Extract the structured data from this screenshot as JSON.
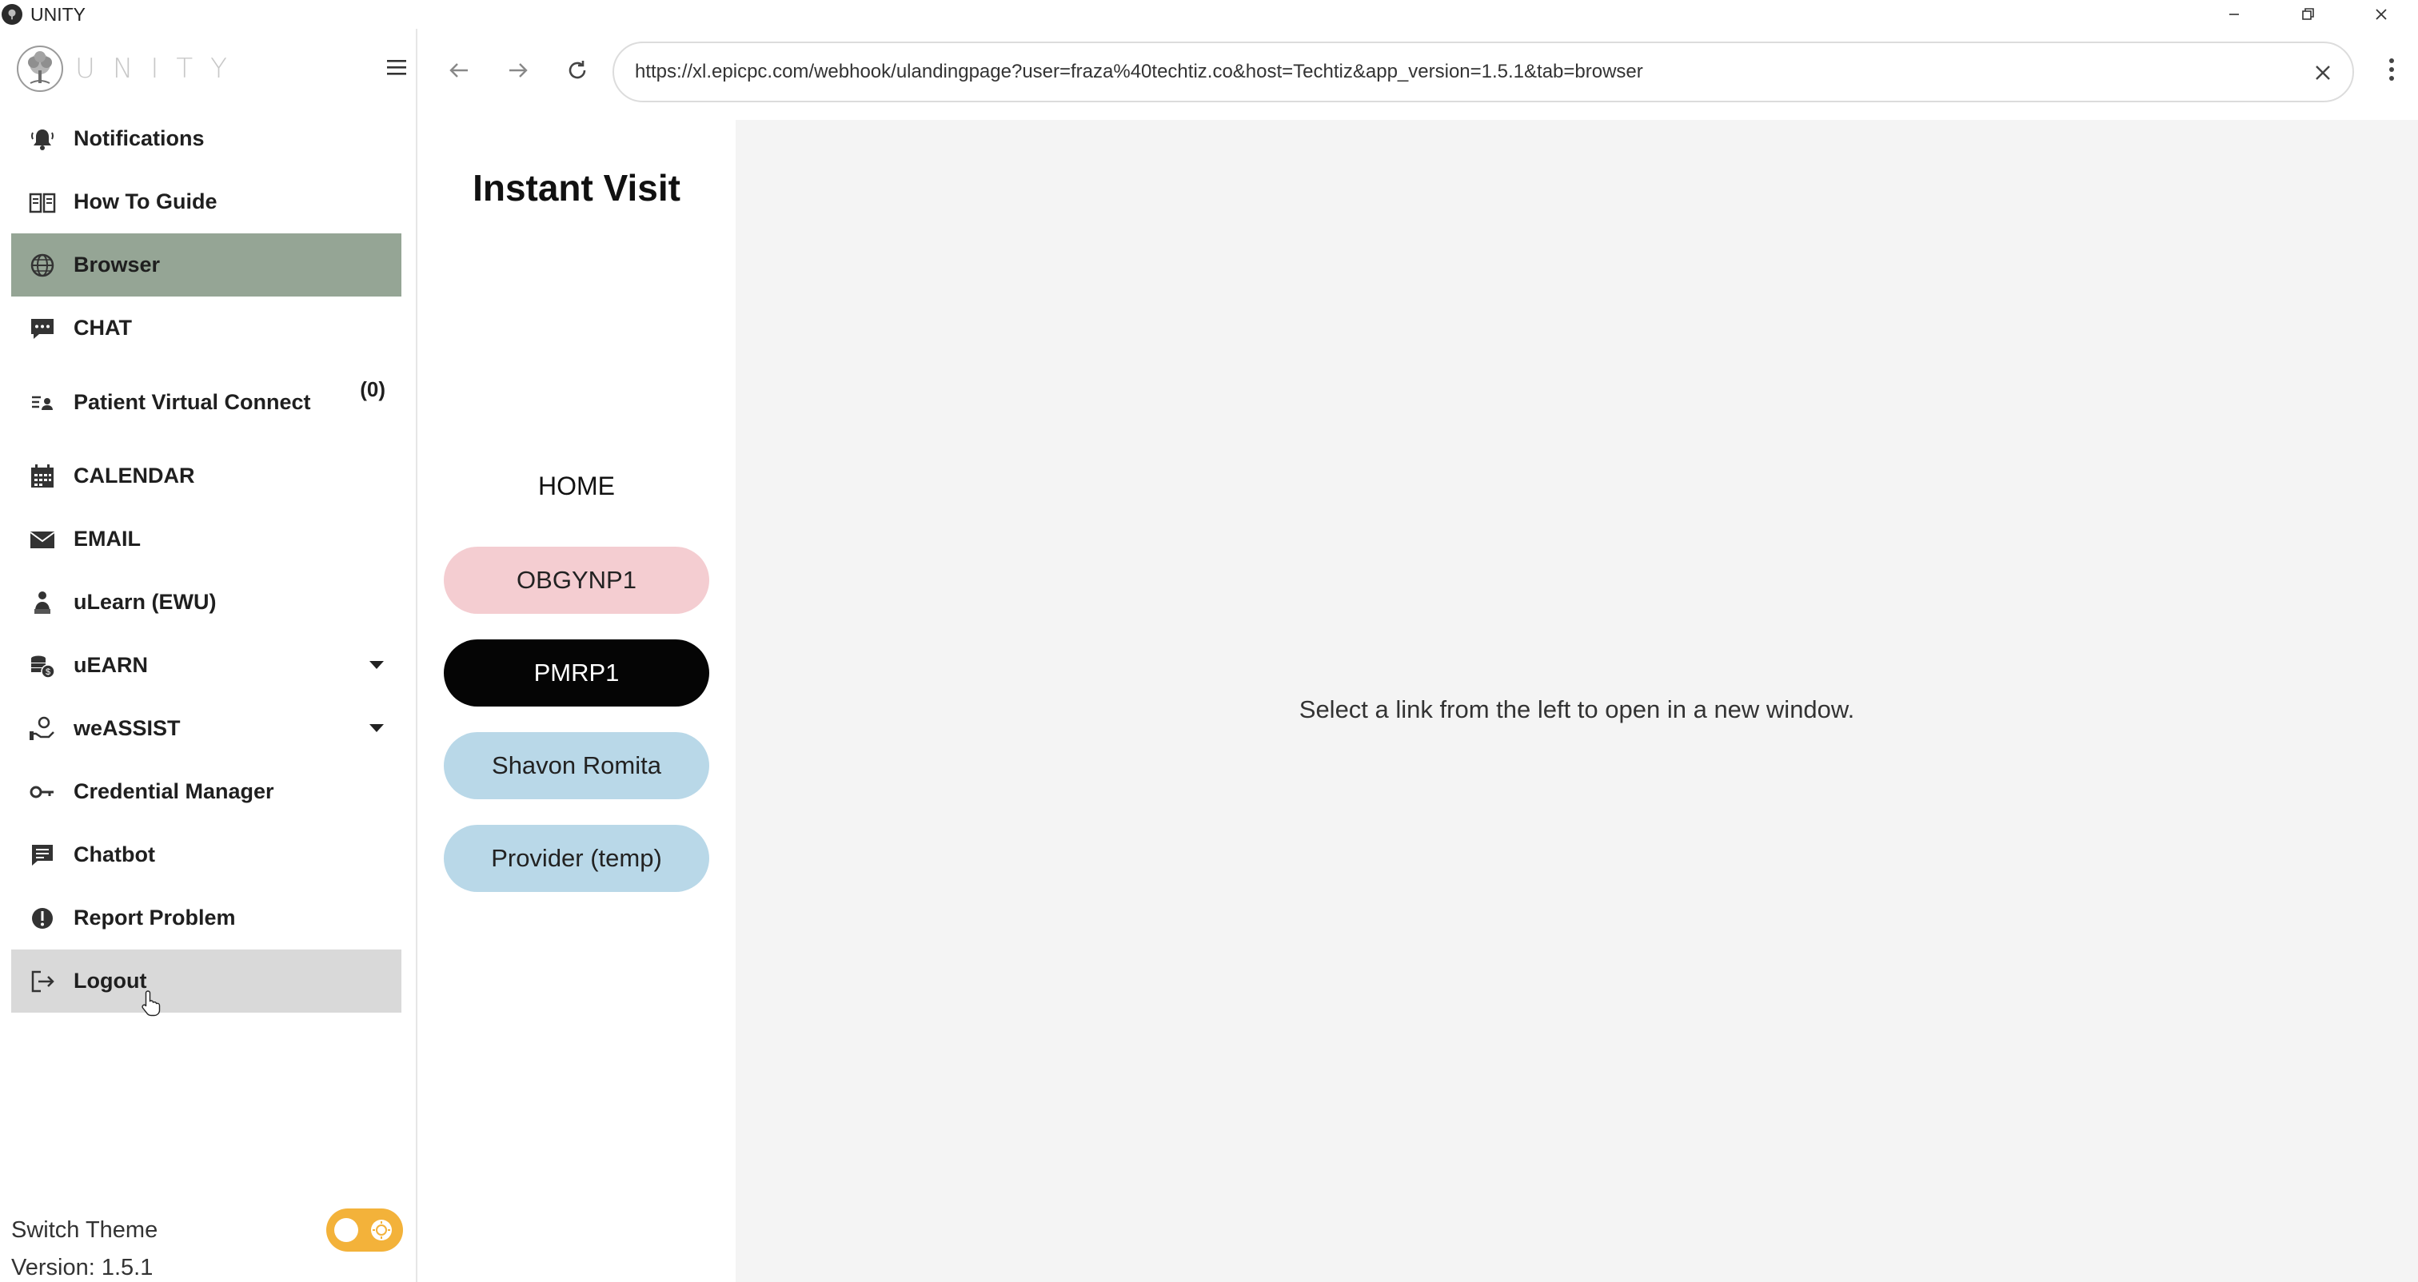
{
  "window": {
    "title": "UNITY",
    "controls": {
      "minimize": "minimize-icon",
      "restore": "restore-icon",
      "close": "close-icon"
    }
  },
  "sidebar": {
    "brand": "UNITY",
    "items": [
      {
        "label": "Notifications",
        "icon": "bell-icon"
      },
      {
        "label": "How To Guide",
        "icon": "book-icon"
      },
      {
        "label": "Browser",
        "icon": "globe-icon",
        "active": true
      },
      {
        "label": "CHAT",
        "icon": "chat-bubble-icon"
      },
      {
        "label": "Patient Virtual Connect",
        "icon": "patient-list-icon",
        "count": "(0)"
      },
      {
        "label": "CALENDAR",
        "icon": "calendar-icon"
      },
      {
        "label": "EMAIL",
        "icon": "envelope-icon"
      },
      {
        "label": "uLearn (EWU)",
        "icon": "learner-icon"
      },
      {
        "label": "uEARN",
        "icon": "coins-icon",
        "expandable": true
      },
      {
        "label": "weASSIST",
        "icon": "helping-hand-icon",
        "expandable": true
      },
      {
        "label": "Credential Manager",
        "icon": "key-icon"
      },
      {
        "label": "Chatbot",
        "icon": "message-square-icon"
      },
      {
        "label": "Report Problem",
        "icon": "alert-circle-icon"
      },
      {
        "label": "Logout",
        "icon": "logout-icon",
        "hovered": true
      }
    ],
    "theme_label": "Switch Theme",
    "version": "Version: 1.5.1"
  },
  "browser": {
    "url": "https://xl.epicpc.com/webhook/ulandingpage?user=fraza%40techtiz.co&host=Techtiz&app_version=1.5.1&tab=browser"
  },
  "left_panel": {
    "title": "Instant Visit",
    "home": "HOME",
    "links": [
      "OBGYNP1",
      "PMRP1",
      "Shavon Romita",
      "Provider (temp)"
    ]
  },
  "main": {
    "message": "Select a link from the left to open in a new window."
  },
  "colors": {
    "active_nav": "#95a595",
    "hover_nav": "#d9d9d9",
    "pill_pink": "#f4cdd1",
    "pill_black": "#050505",
    "pill_blue": "#b9d8e8",
    "theme_toggle": "#f3b23a",
    "main_bg": "#f4f4f4"
  }
}
